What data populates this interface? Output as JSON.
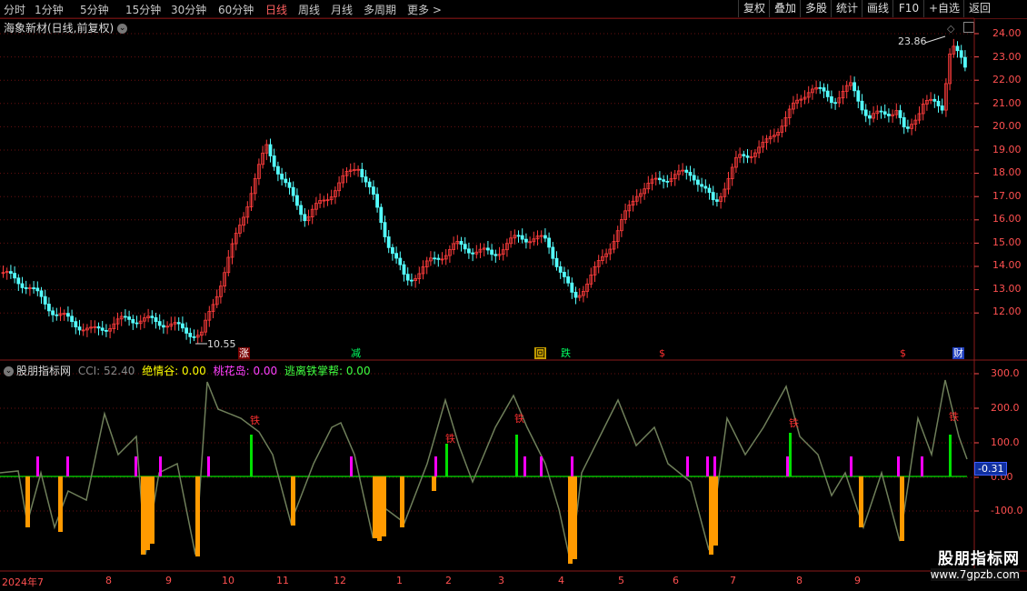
{
  "toolbar": {
    "periods": [
      "分时",
      "1分钟",
      "5分钟",
      "15分钟",
      "30分钟",
      "60分钟",
      "日线",
      "周线",
      "月线",
      "多周期",
      "更多 >"
    ],
    "active_period": "日线",
    "right_buttons": [
      "复权",
      "叠加",
      "多股",
      "统计",
      "画线",
      "F10",
      "+自选",
      "返回"
    ]
  },
  "main": {
    "title": "海象新材(日线,前复权)",
    "price_axis": [
      "24.00",
      "23.00",
      "22.00",
      "21.00",
      "20.00",
      "19.00",
      "18.00",
      "17.00",
      "16.00",
      "15.00",
      "14.00",
      "13.00",
      "12.00"
    ],
    "high_label": "23.86",
    "low_label": "10.55",
    "signals": [
      "涨",
      "减",
      "回",
      "跌",
      "$",
      "$",
      "财"
    ]
  },
  "indicator": {
    "name": "股朋指标网",
    "cci_label": "CCI: 52.40",
    "v1_label": "绝情谷: 0.00",
    "v2_label": "桃花岛: 0.00",
    "v3_label": "逃离铁掌帮: 0.00",
    "axis": [
      "300.0",
      "200.0",
      "100.0",
      "0.00",
      "-100.0"
    ],
    "current_value": "-0.31",
    "marker_text": "铁"
  },
  "time_axis": [
    "2024年7",
    "8",
    "9",
    "10",
    "11",
    "12",
    "1",
    "2",
    "3",
    "4",
    "5",
    "6",
    "7",
    "8",
    "9"
  ],
  "watermark": {
    "title": "股朋指标网",
    "url": "www.7gpzb.com"
  },
  "colors": {
    "up": "#ff3c3c",
    "down": "#54ffff",
    "cci": "#6f7f5a",
    "orange": "#ff9a00",
    "magenta": "#ff00ff",
    "green": "#00e000",
    "grid": "#6a1010"
  }
}
